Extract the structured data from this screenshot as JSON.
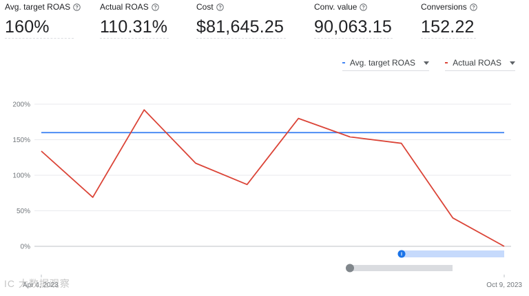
{
  "metrics": [
    {
      "label": "Avg. target ROAS",
      "value": "160%"
    },
    {
      "label": "Actual ROAS",
      "value": "110.31%"
    },
    {
      "label": "Cost",
      "value": "$81,645.25"
    },
    {
      "label": "Conv. value",
      "value": "90,063.15"
    },
    {
      "label": "Conversions",
      "value": "152.22"
    }
  ],
  "legend": {
    "target_label": "Avg. target ROAS",
    "actual_label": "Actual ROAS"
  },
  "colors": {
    "target": "#4285f4",
    "actual": "#db4437",
    "grid": "#e8eaed",
    "baseline": "#bdc1c6",
    "range_fill": "#c6dafc",
    "range_handle": "#1a73e8",
    "scroll_track": "#dadce0",
    "scroll_handle": "#80868b"
  },
  "icons": {
    "help": "help-circle-icon",
    "dropdown": "caret-down-icon"
  },
  "watermark": "IC 大数据观察",
  "chart_data": {
    "type": "line",
    "ylim": [
      0,
      200
    ],
    "yticks": [
      0,
      50,
      100,
      150,
      200
    ],
    "ytick_labels": [
      "0%",
      "50%",
      "100%",
      "150%",
      "200%"
    ],
    "x_labels": [
      "Apr 4, 2023",
      "Oct 9, 2023"
    ],
    "grid": true,
    "legend_position": "top-right",
    "series": [
      {
        "name": "Avg. target ROAS",
        "color": "#4285f4",
        "values": [
          160,
          160,
          160,
          160,
          160,
          160,
          160,
          160,
          160,
          160,
          160
        ]
      },
      {
        "name": "Actual ROAS",
        "color": "#db4437",
        "values": [
          134,
          69,
          192,
          117,
          87,
          180,
          154,
          145,
          40,
          0
        ]
      }
    ],
    "target_points": 2
  }
}
